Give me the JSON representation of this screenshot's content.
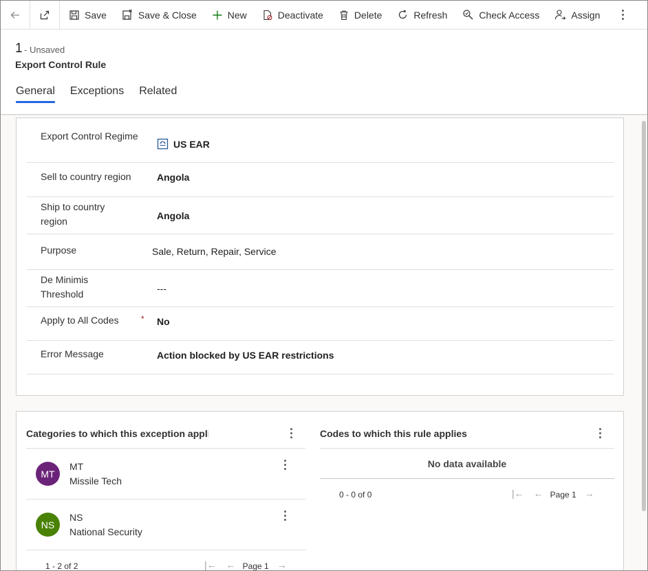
{
  "toolbar": {
    "back_label": "",
    "save": "Save",
    "save_close": "Save & Close",
    "new": "New",
    "deactivate": "Deactivate",
    "delete": "Delete",
    "refresh": "Refresh",
    "check_access": "Check Access",
    "assign": "Assign"
  },
  "header": {
    "record_id": "1",
    "record_state": "- Unsaved",
    "entity_name": "Export Control Rule",
    "tabs": [
      {
        "label": "General",
        "active": true
      },
      {
        "label": "Exceptions",
        "active": false
      },
      {
        "label": "Related",
        "active": false
      }
    ]
  },
  "form": {
    "fields": [
      {
        "label": "Export Control Regime",
        "value": "US EAR",
        "type": "lookup"
      },
      {
        "label": "Sell to country region",
        "value": "Angola"
      },
      {
        "label": "Ship to country region",
        "value": "Angola"
      },
      {
        "label": "Purpose",
        "value": "Sale, Return, Repair, Service"
      },
      {
        "label": "De Minimis Threshold",
        "value": "---"
      },
      {
        "label": "Apply to All Codes",
        "value": "No",
        "required": "*"
      },
      {
        "label": "Error Message",
        "value": "Action blocked by US EAR restrictions"
      }
    ]
  },
  "categories_grid": {
    "title": "Categories to which this exception applies",
    "items": [
      {
        "initials": "MT",
        "code": "MT",
        "name": "Missile Tech",
        "color": "#6b2379"
      },
      {
        "initials": "NS",
        "code": "NS",
        "name": "National Security",
        "color": "#498205"
      }
    ],
    "count": "1 - 2 of 2",
    "page": "Page 1"
  },
  "codes_grid": {
    "title": "Codes to which this rule applies",
    "empty": "No data available",
    "count": "0 - 0 of 0",
    "page": "Page 1"
  },
  "colors": {
    "accent": "#2266e3",
    "lookup_link": "#2b579a",
    "required": "#a4262c"
  }
}
